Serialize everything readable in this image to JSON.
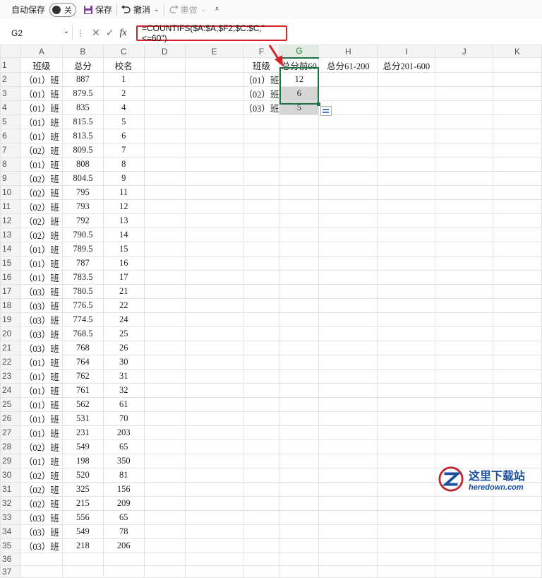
{
  "toolbar": {
    "autosave_label": "自动保存",
    "toggle_label": "关",
    "save_label": "保存",
    "undo_label": "撤消",
    "redo_label": "重做"
  },
  "formula_bar": {
    "name_box": "G2",
    "fx": "fx",
    "formula": "=COUNTIFS($A:$A,$F2,$C:$C,\"<=60\")"
  },
  "columns": [
    "A",
    "B",
    "C",
    "D",
    "E",
    "F",
    "G",
    "H",
    "I",
    "J",
    "K"
  ],
  "selected_column": "G",
  "headers_row": [
    "班级",
    "总分",
    "校名"
  ],
  "summary_headers": {
    "F": "班级",
    "G": "总分前60",
    "H": "总分61-200",
    "I": "总分201-600"
  },
  "summary_rows": [
    {
      "class": "（01）班",
      "count": "12"
    },
    {
      "class": "（02）班",
      "count": "6"
    },
    {
      "class": "（03）班",
      "count": "5"
    }
  ],
  "rows": [
    [
      "（01）班",
      "887",
      "1"
    ],
    [
      "（01）班",
      "879.5",
      "2"
    ],
    [
      "（01）班",
      "835",
      "4"
    ],
    [
      "（01）班",
      "815.5",
      "5"
    ],
    [
      "（01）班",
      "813.5",
      "6"
    ],
    [
      "（02）班",
      "809.5",
      "7"
    ],
    [
      "（01）班",
      "808",
      "8"
    ],
    [
      "（02）班",
      "804.5",
      "9"
    ],
    [
      "（02）班",
      "795",
      "11"
    ],
    [
      "（02）班",
      "793",
      "12"
    ],
    [
      "（02）班",
      "792",
      "13"
    ],
    [
      "（02）班",
      "790.5",
      "14"
    ],
    [
      "（01）班",
      "789.5",
      "15"
    ],
    [
      "（01）班",
      "787",
      "16"
    ],
    [
      "（01）班",
      "783.5",
      "17"
    ],
    [
      "（03）班",
      "780.5",
      "21"
    ],
    [
      "（03）班",
      "776.5",
      "22"
    ],
    [
      "（03）班",
      "774.5",
      "24"
    ],
    [
      "（03）班",
      "768.5",
      "25"
    ],
    [
      "（03）班",
      "768",
      "26"
    ],
    [
      "（01）班",
      "764",
      "30"
    ],
    [
      "（01）班",
      "762",
      "31"
    ],
    [
      "（01）班",
      "761",
      "32"
    ],
    [
      "（01）班",
      "562",
      "61"
    ],
    [
      "（01）班",
      "531",
      "70"
    ],
    [
      "（01）班",
      "231",
      "203"
    ],
    [
      "（02）班",
      "549",
      "65"
    ],
    [
      "（01）班",
      "198",
      "350"
    ],
    [
      "（02）班",
      "520",
      "81"
    ],
    [
      "（02）班",
      "325",
      "156"
    ],
    [
      "（02）班",
      "215",
      "209"
    ],
    [
      "（03）班",
      "556",
      "65"
    ],
    [
      "（03）班",
      "549",
      "78"
    ],
    [
      "（03）班",
      "218",
      "206"
    ]
  ],
  "watermark": {
    "cn": "这里下载站",
    "en": "heredown.com"
  }
}
